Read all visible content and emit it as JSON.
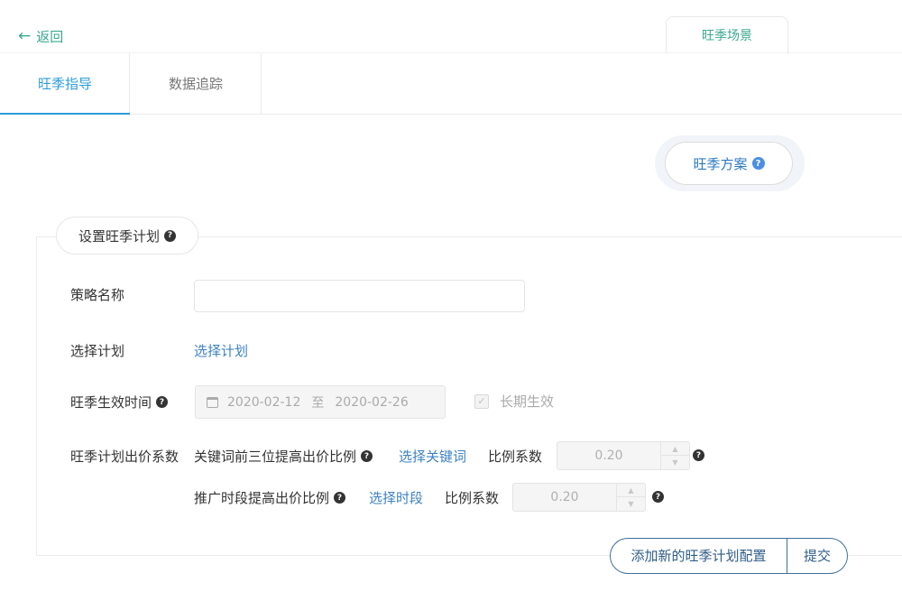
{
  "header": {
    "back_label": "返回",
    "scene_tab": "旺季场景"
  },
  "tabs": [
    {
      "label": "旺季指导",
      "active": true
    },
    {
      "label": "数据追踪",
      "active": false
    }
  ],
  "plan_button": {
    "label": "旺季方案"
  },
  "form": {
    "title": "设置旺季计划",
    "strategy_name": {
      "label": "策略名称",
      "value": "",
      "placeholder": ""
    },
    "select_plan": {
      "label": "选择计划",
      "link": "选择计划"
    },
    "effective_time": {
      "label": "旺季生效时间",
      "start": "2020-02-12",
      "separator": "至",
      "end": "2020-02-26",
      "long_term_label": "长期生效",
      "long_term_checked": true
    },
    "bid_coefficient": {
      "label": "旺季计划出价系数",
      "keyword_row": {
        "label": "关键词前三位提高出价比例",
        "link": "选择关键词",
        "ratio_label": "比例系数",
        "value": "0.20"
      },
      "time_row": {
        "label": "推广时段提高出价比例",
        "link": "选择时段",
        "ratio_label": "比例系数",
        "value": "0.20"
      }
    }
  },
  "actions": {
    "add_config": "添加新的旺季计划配置",
    "submit": "提交"
  },
  "colors": {
    "accent_teal": "#3aa891",
    "tab_active": "#2d9cdb",
    "link_blue": "#3e82c4",
    "action_border": "#3e6f9c"
  }
}
